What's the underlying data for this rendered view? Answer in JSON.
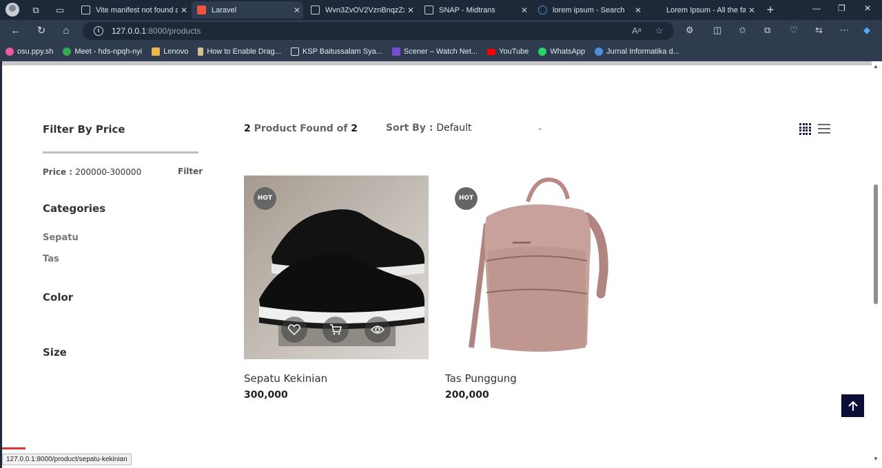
{
  "browser": {
    "tabs": [
      {
        "title": "Vite manifest not found a",
        "active": false
      },
      {
        "title": "Laravel",
        "active": true
      },
      {
        "title": "Wvn3ZvOV2VznBnqzZxlT",
        "active": false
      },
      {
        "title": "SNAP - Midtrans",
        "active": false
      },
      {
        "title": "lorem ipsum - Search",
        "active": false
      },
      {
        "title": "Lorem Ipsum - All the fac",
        "active": false
      }
    ],
    "url_host": "127.0.0.1",
    "url_rest": ":8000/products",
    "bookmarks": [
      {
        "label": "osu.ppy.sh",
        "color": "#e85a9a"
      },
      {
        "label": "Meet - hds-npqh-nyi",
        "color": "#34a853"
      },
      {
        "label": "Lenovo",
        "color": "#e8b84a"
      },
      {
        "label": "How to Enable Drag...",
        "color": "#d9c08a"
      },
      {
        "label": "KSP Baitussalam Sya...",
        "color": "#dfe4ea"
      },
      {
        "label": "Scener – Watch Net...",
        "color": "#7b4bd6"
      },
      {
        "label": "YouTube",
        "color": "#ff0000"
      },
      {
        "label": "WhatsApp",
        "color": "#25d366"
      },
      {
        "label": "Jurnal Informatika d...",
        "color": "#4a90d9"
      }
    ],
    "status_url": "127.0.0.1:8000/product/sepatu-kekinian"
  },
  "sidebar": {
    "price_heading": "Filter By Price",
    "price_label": "Price :",
    "price_value": "200000-300000",
    "filter_label": "Filter",
    "categories_heading": "Categories",
    "categories": [
      "Sepatu",
      "Tas"
    ],
    "color_heading": "Color",
    "size_heading": "Size"
  },
  "toolbar": {
    "found_count": "2",
    "found_text": "Product Found of",
    "found_total": "2",
    "sort_label": "Sort By :",
    "sort_value": "Default"
  },
  "products": [
    {
      "name": "Sepatu Kekinian",
      "price": "300,000",
      "badge": "HOT"
    },
    {
      "name": "Tas Punggung",
      "price": "200,000",
      "badge": "HOT"
    }
  ],
  "colors": {
    "accent": "#0d0d3a",
    "browser_chrome": "#2f3b4e"
  }
}
